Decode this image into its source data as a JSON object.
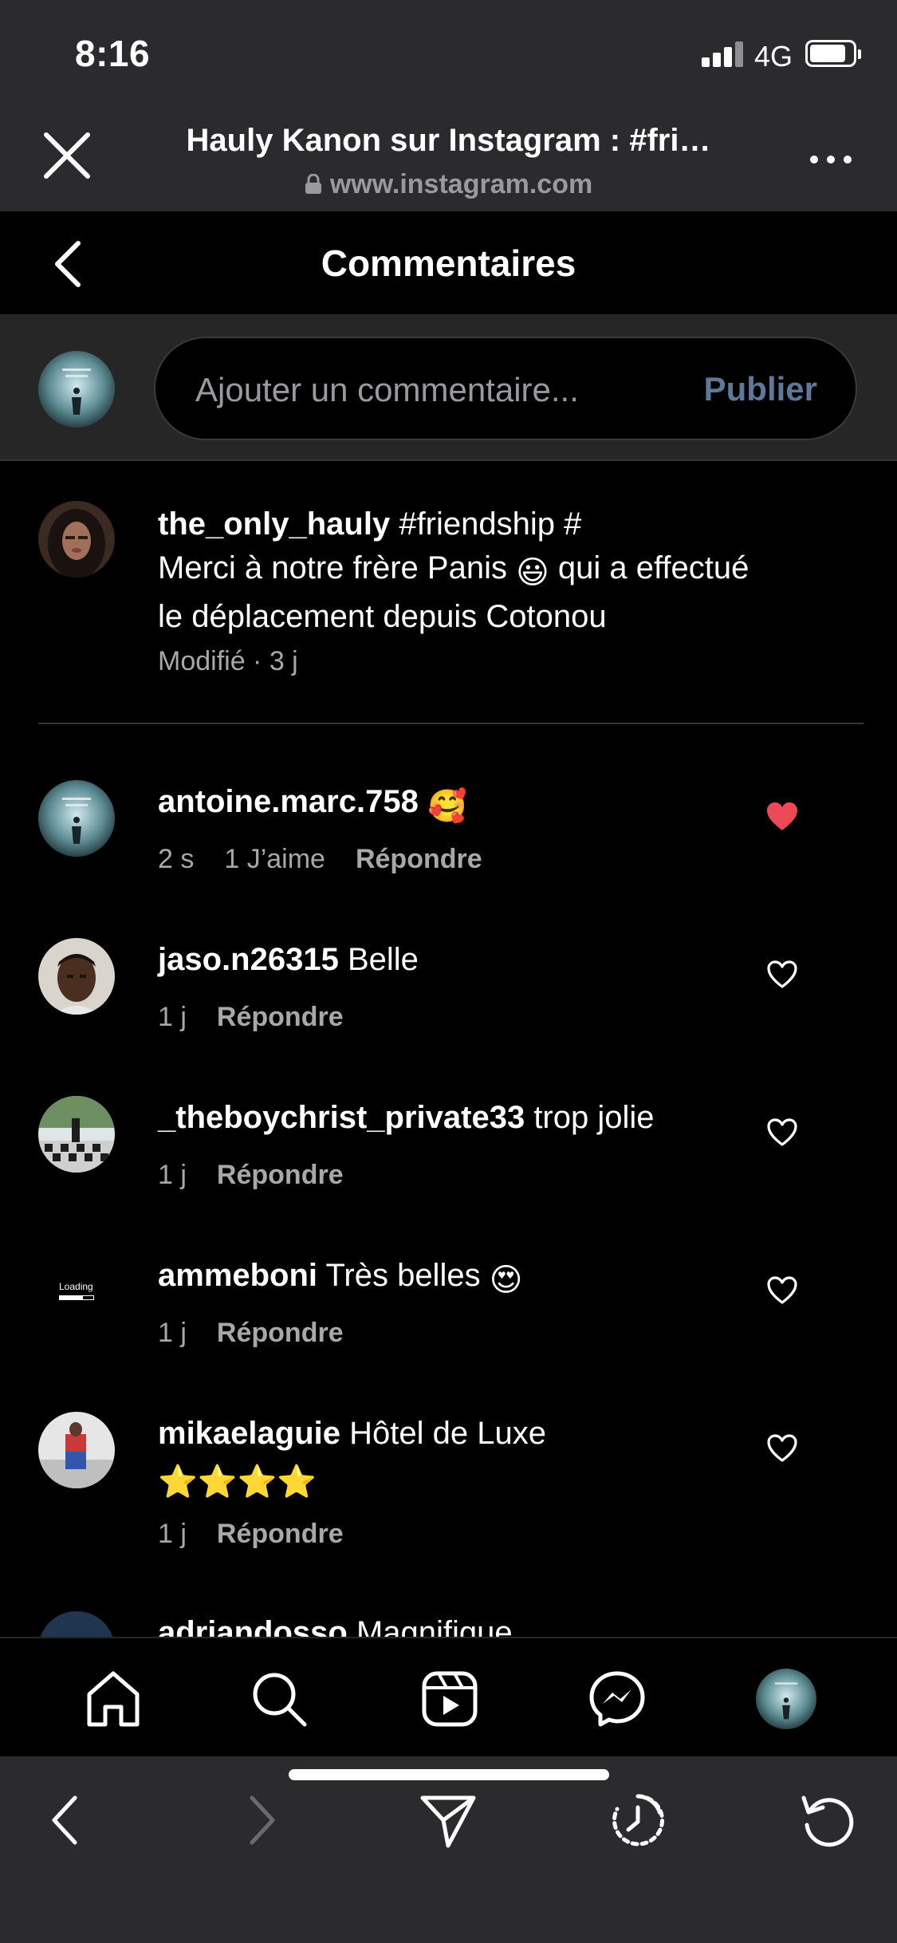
{
  "status_bar": {
    "time": "8:16",
    "network": "4G"
  },
  "browser": {
    "page_title": "Hauly Kanon sur Instagram : #fri…",
    "url": "www.instagram.com"
  },
  "header": {
    "title": "Commentaires"
  },
  "composer": {
    "placeholder": "Ajouter un commentaire...",
    "publish_label": "Publier"
  },
  "caption": {
    "username": "the_only_hauly",
    "text_before": " #friendship #",
    "line2_before": "Merci à notre frère Panis ",
    "emoji": "😃",
    "line2_after": " qui a effectué",
    "line3": "le déplacement depuis Cotonou",
    "meta": "Modifié · 3 j"
  },
  "comments": [
    {
      "username": "antoine.marc.758",
      "text": "",
      "emoji": "🥰",
      "time": "2 s",
      "likes": "1 J’aime",
      "reply": "Répondre",
      "liked": true
    },
    {
      "username": "jaso.n26315",
      "text": " Belle",
      "emoji": "",
      "time": "1 j",
      "likes": "",
      "reply": "Répondre",
      "liked": false
    },
    {
      "username": "_theboychrist_private33",
      "text": " trop jolie",
      "emoji": "",
      "time": "1 j",
      "likes": "",
      "reply": "Répondre",
      "liked": false
    },
    {
      "username": "ammeboni",
      "text": " Très belles ",
      "emoji": "😍",
      "time": "1 j",
      "likes": "",
      "reply": "Répondre",
      "liked": false,
      "avatar_text": "Loading"
    },
    {
      "username": "mikaelaguie",
      "text": " Hôtel de Luxe",
      "emoji": "⭐⭐⭐⭐",
      "time": "1 j",
      "likes": "",
      "reply": "Répondre",
      "liked": false
    },
    {
      "username": "adriandosso",
      "text": " Magnifique"
    }
  ],
  "bottom_nav": [
    "home-icon",
    "search-icon",
    "reels-icon",
    "messenger-icon",
    "profile-avatar"
  ],
  "browser_toolbar": [
    "back-icon",
    "forward-icon",
    "share-icon",
    "history-icon",
    "reload-icon"
  ],
  "colors": {
    "like_red": "#ed4956",
    "publish_disabled": "#5f7899",
    "muted_text": "#a8a8a8"
  }
}
